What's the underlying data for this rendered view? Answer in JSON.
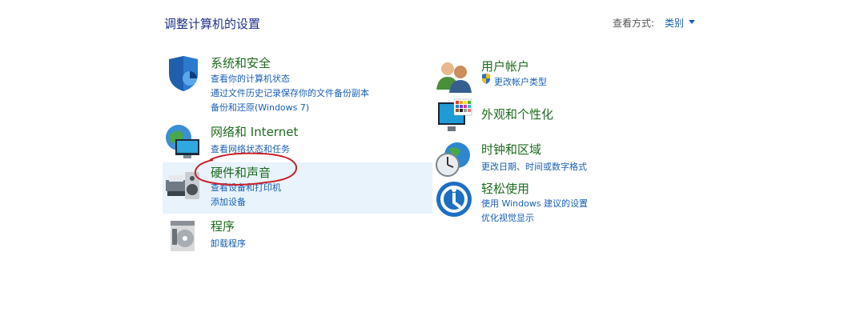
{
  "page": {
    "title": "调整计算机的设置"
  },
  "view_by": {
    "label": "查看方式:",
    "value": "类别"
  },
  "left": {
    "system": {
      "title": "系统和安全",
      "links": [
        "查看你的计算机状态",
        "通过文件历史记录保存你的文件备份副本",
        "备份和还原(Windows 7)"
      ],
      "icon": "shield-icon"
    },
    "network": {
      "title": "网络和 Internet",
      "links": [
        "查看网络状态和任务"
      ],
      "icon": "network-globe-icon"
    },
    "hardware": {
      "title": "硬件和声音",
      "links": [
        "查看设备和打印机",
        "添加设备"
      ],
      "icon": "printer-speaker-icon"
    },
    "programs": {
      "title": "程序",
      "links": [
        "卸载程序"
      ],
      "icon": "programs-disc-icon"
    }
  },
  "right": {
    "accounts": {
      "title": "用户帐户",
      "links": [
        "更改帐户类型"
      ],
      "icon": "users-icon"
    },
    "appearance": {
      "title": "外观和个性化",
      "links": [],
      "icon": "monitor-palette-icon"
    },
    "clock": {
      "title": "时钟和区域",
      "links": [
        "更改日期、时间或数字格式"
      ],
      "icon": "clock-globe-icon"
    },
    "ease": {
      "title": "轻松使用",
      "links": [
        "使用 Windows 建议的设置",
        "优化视觉显示"
      ],
      "icon": "ease-of-access-icon"
    }
  },
  "colors": {
    "heading_green": "#1e6b1e",
    "link_blue": "#1a5fb4",
    "hover_bg": "#e8f3fb",
    "annotation_red": "#c8202a"
  }
}
